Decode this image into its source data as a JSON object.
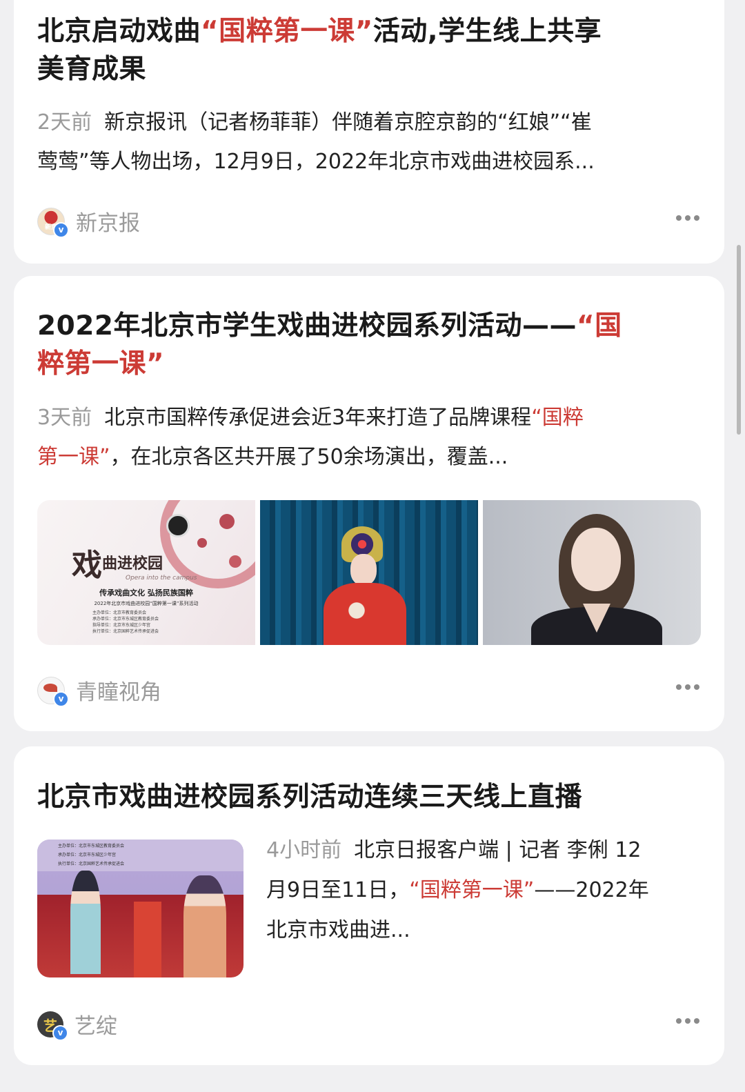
{
  "articles": [
    {
      "title_a": "北京启动戏曲",
      "title_hl": "“国粹第一课”",
      "title_b": "活动,学生线上共享",
      "title_c": "美育成果",
      "time": "2天前",
      "summary_1": "新京报讯（记者杨菲菲）伴随着京腔京韵的“红娘”“崔",
      "summary_2": "莺莺”等人物出场，12月9日，2022年北京市戏曲进校园系...",
      "source": "新京报",
      "logo_text": "新京"
    },
    {
      "title_a": "2022年北京市学生戏曲进校园系列活动——",
      "title_hl_1": "“国",
      "title_hl_2": "粹第一课”",
      "time": "3天前",
      "summary_1": "北京市国粹传承促进会近3年来打造了品牌课程",
      "summary_hl_1": "“国粹",
      "summary_hl_2": "第一课”",
      "summary_2": "，在北京各区共开展了50余场演出，覆盖...",
      "source": "青瞳视角",
      "poster": {
        "title_1": "戏",
        "title_2": "曲进校园",
        "subtitle": "Opera into the campus",
        "slogan": "传承戏曲文化 弘扬民族国粹",
        "event": "2022年北京市戏曲进校园“国粹第一课”系列活动",
        "org_1": "主办单位：北京市教育委员会",
        "org_2": "承办单位：北京市东城区教育委员会",
        "org_3": "指导单位：北京市东城区少年宫",
        "org_4": "执行单位：北京国粹艺术传承促进会"
      }
    },
    {
      "title": "北京市戏曲进校园系列活动连续三天线上直播",
      "time": "4小时前",
      "summary_1": "北京日报客户端 | 记者 李俐 12",
      "summary_2a": "月9日至11日，",
      "summary_hl": "“国粹第一课”",
      "summary_2b": "——2022年",
      "summary_3": "北京市戏曲进...",
      "source": "艺绽",
      "logo_text": "艺",
      "banner_1": "主办单位：北京市东城区教育委员会",
      "banner_2": "承办单位：北京市东城区少年宫",
      "banner_3": "执行单位：北京国粹艺术传承促进会"
    }
  ],
  "colors": {
    "highlight": "#cc3b35",
    "verify": "#3f86e8"
  },
  "icons": [
    "verified-badge-icon",
    "more-options-icon"
  ]
}
